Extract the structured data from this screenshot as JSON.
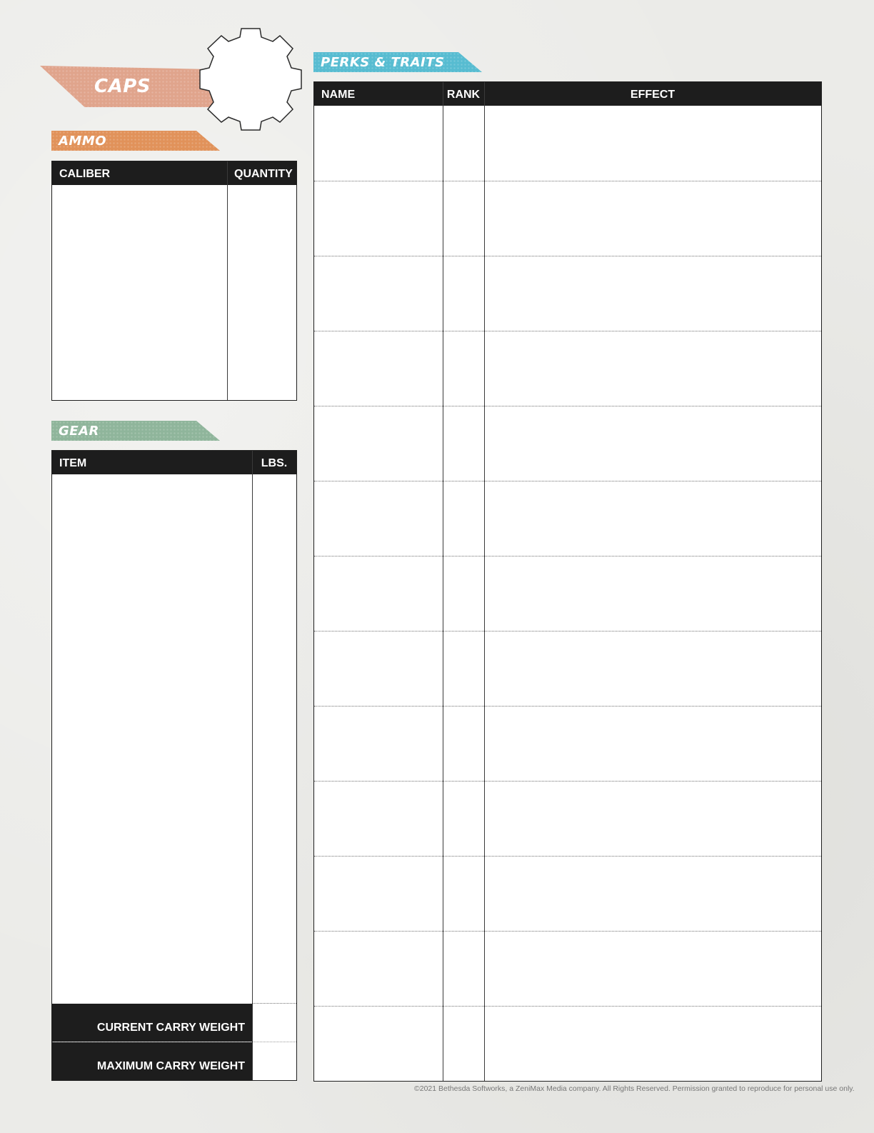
{
  "caps": {
    "label": "CAPS",
    "color": "#e0a48c",
    "icon": "gear-icon"
  },
  "ammo": {
    "label": "AMMO",
    "color": "#e1925a",
    "columns": [
      "CALIBER",
      "QUANTITY"
    ]
  },
  "gear": {
    "label": "GEAR",
    "color": "#8fb59b",
    "columns": [
      "ITEM",
      "LBS."
    ],
    "current_carry_weight_label": "CURRENT CARRY WEIGHT",
    "maximum_carry_weight_label": "MAXIMUM CARRY WEIGHT"
  },
  "perks": {
    "label": "PERKS & TRAITS",
    "color": "#57bcd1",
    "columns": [
      "NAME",
      "RANK",
      "EFFECT"
    ],
    "row_count": 13
  },
  "footer": {
    "text": "©2021 Bethesda Softworks, a ZeniMax Media company. All Rights Reserved. Permission granted to reproduce for personal use only."
  }
}
